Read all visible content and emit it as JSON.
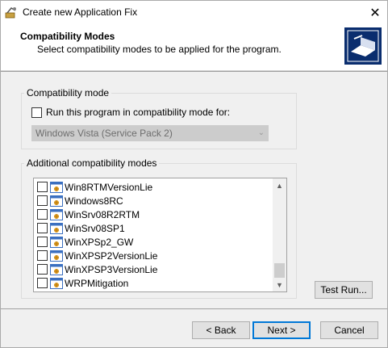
{
  "window": {
    "title": "Create new Application Fix"
  },
  "header": {
    "title": "Compatibility Modes",
    "subtitle": "Select compatibility modes to be applied for the program."
  },
  "compat_mode": {
    "group_label": "Compatibility mode",
    "checkbox_label": "Run this program in compatibility mode for:",
    "checked": false,
    "selected_os": "Windows Vista (Service Pack 2)"
  },
  "additional": {
    "group_label": "Additional compatibility modes",
    "items": [
      {
        "label": "Win8RTMVersionLie",
        "checked": false
      },
      {
        "label": "Windows8RC",
        "checked": false
      },
      {
        "label": "WinSrv08R2RTM",
        "checked": false
      },
      {
        "label": "WinSrv08SP1",
        "checked": false
      },
      {
        "label": "WinXPSp2_GW",
        "checked": false
      },
      {
        "label": "WinXPSP2VersionLie",
        "checked": false
      },
      {
        "label": "WinXPSP3VersionLie",
        "checked": false
      },
      {
        "label": "WRPMitigation",
        "checked": false
      }
    ]
  },
  "buttons": {
    "test_run": "Test Run...",
    "back": "< Back",
    "next": "Next >",
    "cancel": "Cancel"
  },
  "colors": {
    "accent": "#0078d7",
    "disabled_combo": "#cccccc"
  }
}
